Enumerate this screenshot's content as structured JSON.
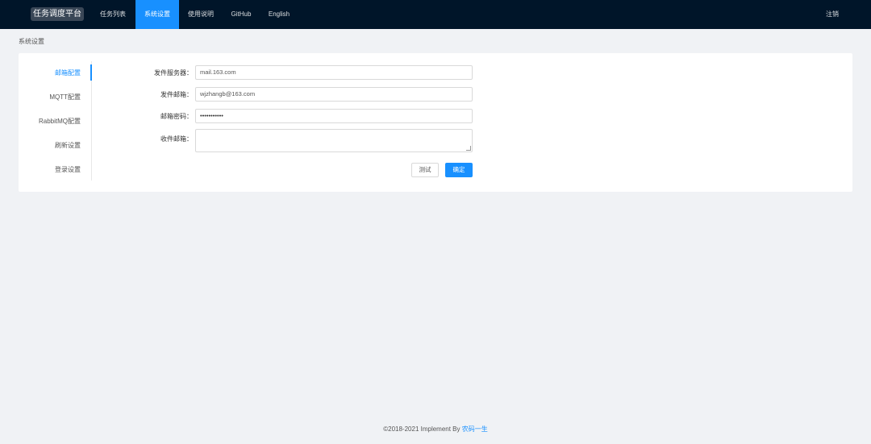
{
  "navbar": {
    "brand": "任务调度平台",
    "items": [
      {
        "label": "任务列表",
        "active": false
      },
      {
        "label": "系统设置",
        "active": true
      },
      {
        "label": "使用说明",
        "active": false
      },
      {
        "label": "GitHub",
        "active": false
      },
      {
        "label": "English",
        "active": false
      }
    ],
    "logout": "注销"
  },
  "breadcrumb": "系统设置",
  "side_menu": {
    "items": [
      {
        "label": "邮箱配置",
        "active": true
      },
      {
        "label": "MQTT配置",
        "active": false
      },
      {
        "label": "RabbitMQ配置",
        "active": false
      },
      {
        "label": "刷新设置",
        "active": false
      },
      {
        "label": "登录设置",
        "active": false
      }
    ]
  },
  "form": {
    "smtp_label": "发件服务器：",
    "smtp_value": "mail.163.com",
    "sender_label": "发件邮箱：",
    "sender_value": "wjzhangb@163.com",
    "password_label": "邮箱密码：",
    "password_value": "•••••••••••",
    "receiver_label": "收件邮箱：",
    "receiver_value": ""
  },
  "buttons": {
    "test": "测试",
    "confirm": "确定"
  },
  "footer": {
    "text": "©2018-2021 Implement By ",
    "author": "农码一生"
  },
  "colors": {
    "nav_bg": "#001529",
    "accent": "#1890ff",
    "page_bg": "#f0f2f5"
  }
}
